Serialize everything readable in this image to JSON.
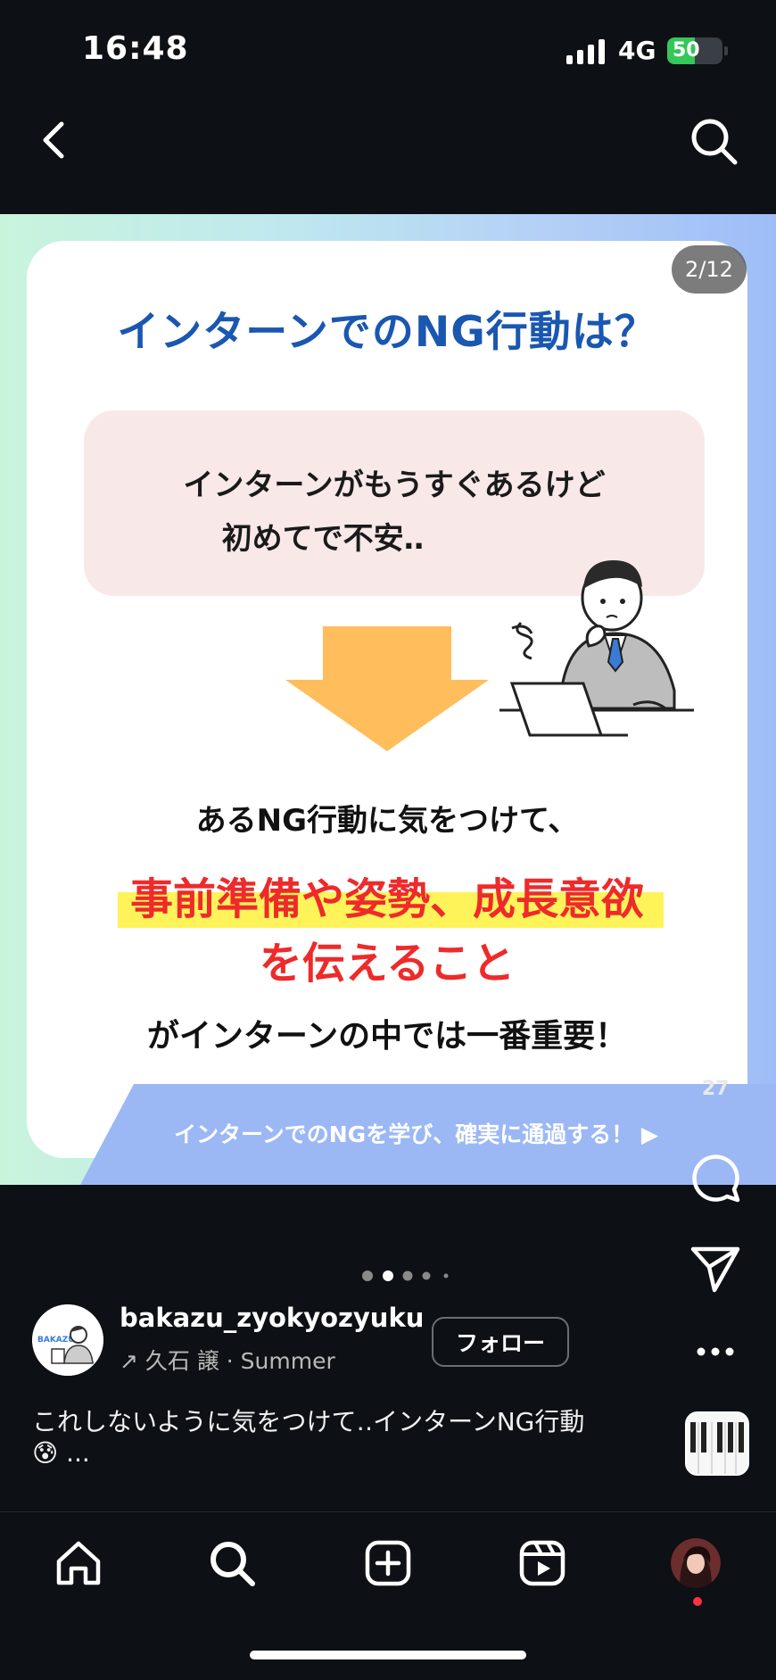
{
  "status_bar": {
    "time": "16:48",
    "network": "4G",
    "battery": "50",
    "battery_level": 0.5
  },
  "slide": {
    "counter": "2/12",
    "title": "インターンでのNG行動は？",
    "worry_line1": "インターンがもうすぐあるけど",
    "worry_line2": "初めてで不安‥",
    "ng_line": "あるNG行動に気をつけて、",
    "red_line1": "事前準備や姿勢、成長意欲",
    "red_line2": "を伝えること",
    "black_line": "がインターンの中では一番重要！",
    "band_text": "インターンでのNGを学び、確実に通過する！ ▶",
    "accent_colors": {
      "title": "#1a57b0",
      "red": "#ee2a2a",
      "highlight": "#fff35a",
      "arrow": "#ffbd5c"
    }
  },
  "actions": {
    "like_count": "27"
  },
  "pagination": {
    "current": 2
  },
  "author": {
    "avatar_text": "BAKAZU",
    "username": "bakazu_zyokyozyuku",
    "music": "↗ 久石 譲 · Summer",
    "follow_label": "フォロー"
  },
  "caption": {
    "line1": "これしないように気をつけて‥インターンNG行動",
    "line2": "😰 ..."
  },
  "icons": {
    "back": "chevron-left-icon",
    "search": "search-icon",
    "like": "heart-icon",
    "comment": "comment-icon",
    "share": "send-icon",
    "more": "more-icon",
    "home": "home-icon",
    "create": "plus-square-icon",
    "reels": "reels-icon"
  }
}
